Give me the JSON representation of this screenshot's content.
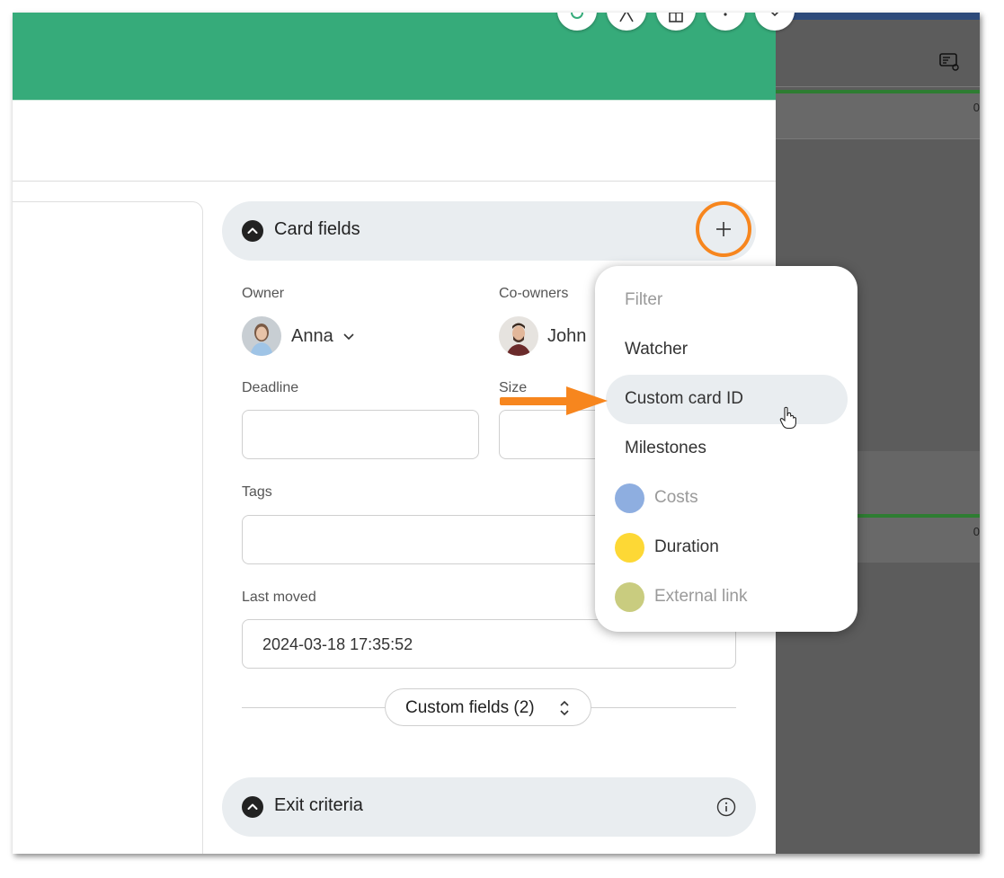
{
  "card_fields": {
    "title": "Card fields",
    "owner_label": "Owner",
    "owner_name": "Anna",
    "coowners_label": "Co-owners",
    "coowner_name": "John",
    "deadline_label": "Deadline",
    "size_label": "Size",
    "tags_label": "Tags",
    "last_moved_label": "Last moved",
    "last_moved_value": "2024-03-18 17:35:52",
    "custom_fields_label": "Custom fields (2)"
  },
  "exit_criteria": {
    "title": "Exit criteria"
  },
  "add_menu": {
    "items": [
      {
        "label": "Filter",
        "enabled": true
      },
      {
        "label": "Watcher",
        "enabled": true
      },
      {
        "label": "Custom card ID",
        "enabled": true,
        "hovered": true
      },
      {
        "label": "Milestones",
        "enabled": true
      },
      {
        "label": "Costs",
        "enabled": false,
        "color": "#8eaee0"
      },
      {
        "label": "Duration",
        "enabled": true,
        "color": "#fdd835"
      },
      {
        "label": "External link",
        "enabled": false,
        "color": "#c9cc7f"
      }
    ]
  },
  "colors": {
    "header": "#36ab7a",
    "highlight": "#f7861e",
    "backdrop": "#5c5c5c"
  },
  "backdrop": {
    "row_digit": "0"
  },
  "icons": [
    "collapse-chevron-icon",
    "plus-icon",
    "chevron-down-icon",
    "sort-updown-icon",
    "info-icon",
    "pointer-hand-icon",
    "arrow-icon"
  ]
}
